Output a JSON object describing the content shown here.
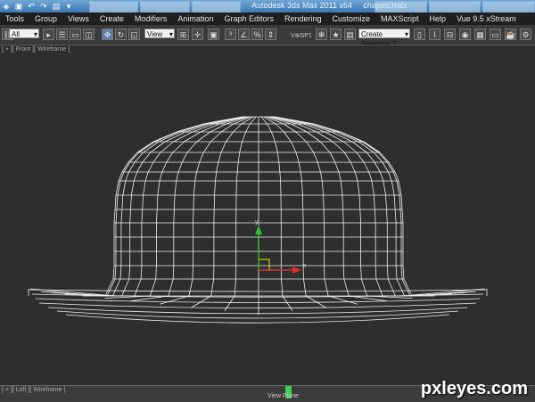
{
  "titlebar": {
    "app_title": "Autodesk 3ds Max  2011 x64",
    "file_name": "chapeu.max"
  },
  "menu": [
    "Tools",
    "Group",
    "Views",
    "Create",
    "Modifiers",
    "Animation",
    "Graph Editors",
    "Rendering",
    "Customize",
    "MAXScript",
    "Help",
    "Vue 9.5 xStream"
  ],
  "toolbar": {
    "selection_filter": "All",
    "reference_coord": "View",
    "named_selection": "Create Selection S"
  },
  "viewport": {
    "label": "[ + ][ Front ][ Wireframe ]",
    "axis_x": "x",
    "axis_y": "y"
  },
  "trackbar": {
    "label": "[ + ][ Left ][ Wireframe ]",
    "slider_label": "View Plane"
  },
  "watermark": "pxleyes.com",
  "colors": {
    "wire": "#f0f0f0",
    "axis_x": "#e03030",
    "axis_y": "#30c030",
    "slider": "#3ed04a"
  }
}
